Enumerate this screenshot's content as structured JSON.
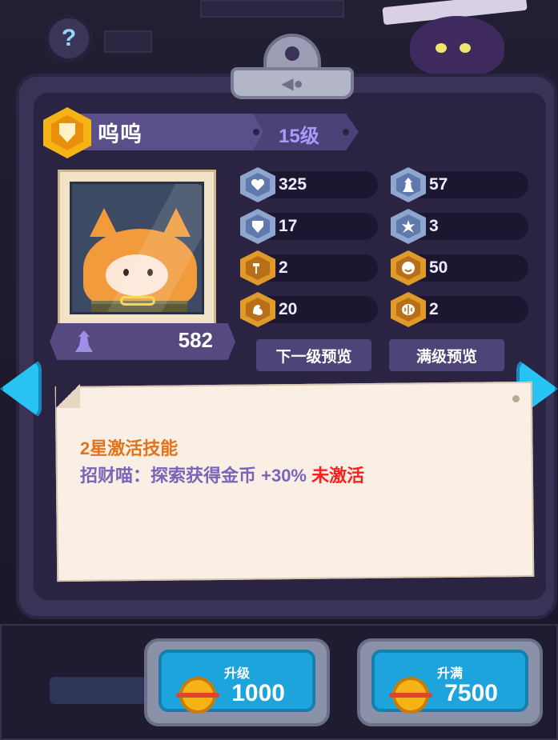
{
  "hero": {
    "name": "呜呜",
    "level": "15级",
    "power": "582"
  },
  "stats": [
    {
      "icon": "heart-icon",
      "value": "325",
      "hex_color": "blue"
    },
    {
      "icon": "tower-icon",
      "value": "57",
      "hex_color": "blue"
    },
    {
      "icon": "shield-icon",
      "value": "17",
      "hex_color": "blue"
    },
    {
      "icon": "impact-icon",
      "value": "3",
      "hex_color": "blue"
    },
    {
      "icon": "hammer-icon",
      "value": "2",
      "hex_color": "gold"
    },
    {
      "icon": "smile-icon",
      "value": "50",
      "hex_color": "gold"
    },
    {
      "icon": "muscle-icon",
      "value": "20",
      "hex_color": "gold"
    },
    {
      "icon": "brain-icon",
      "value": "2",
      "hex_color": "gold"
    }
  ],
  "buttons": {
    "next_level_preview": "下一级预览",
    "max_level_preview": "满级预览"
  },
  "skill": {
    "title": "2星激活技能",
    "description": "招财喵：探索获得金币 +30%",
    "status": "未激活"
  },
  "upgrade": {
    "label": "升级",
    "cost": "1000"
  },
  "upgrade_max": {
    "label": "升满",
    "cost": "7500"
  },
  "colors": {
    "panel": "#3a3357",
    "accent_blue": "#1ea4dc",
    "skill_title": "#e2731a",
    "skill_status": "#ff1e1e"
  }
}
